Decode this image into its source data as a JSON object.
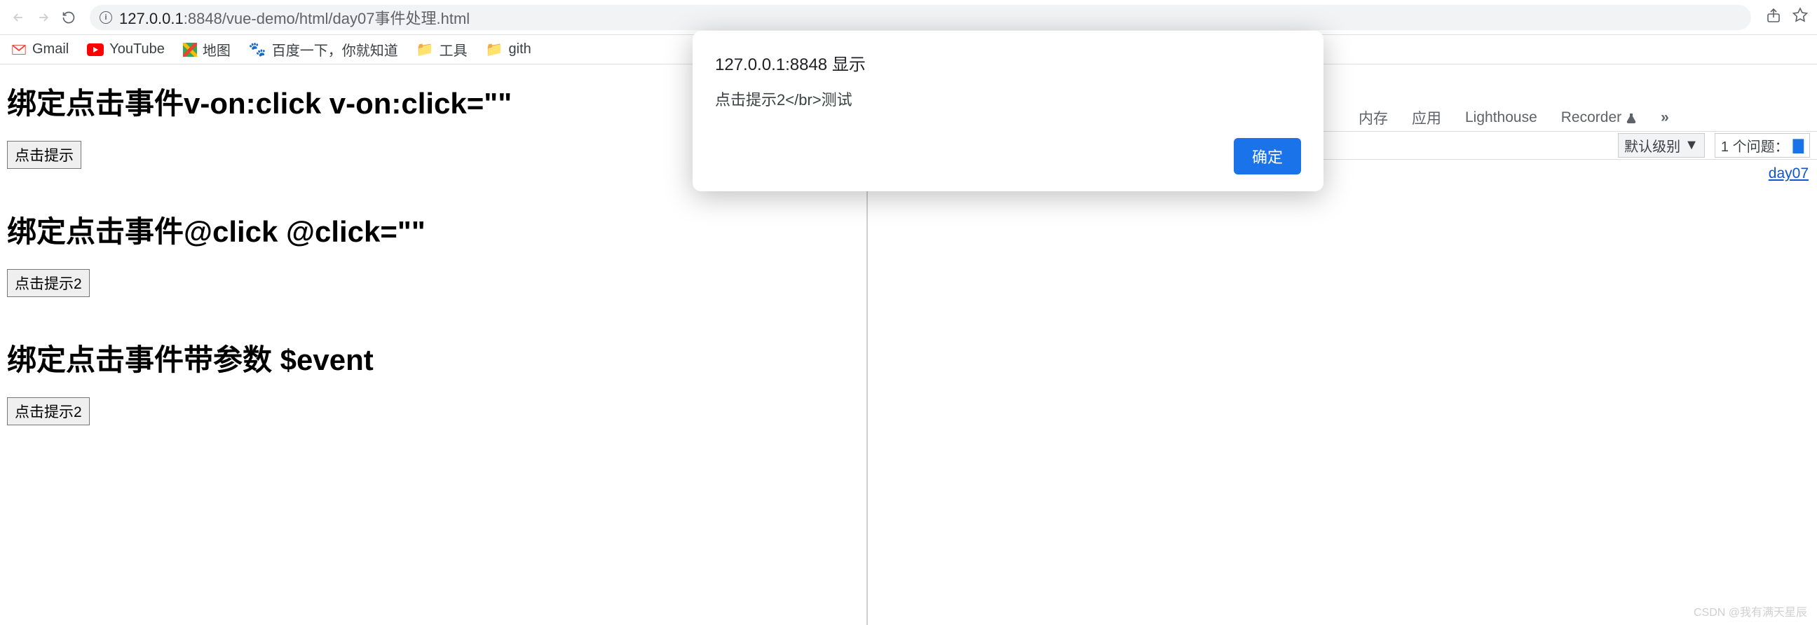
{
  "browser": {
    "url_host": "127.0.0.1",
    "url_port": ":8848",
    "url_path": "/vue-demo/html/day07事件处理.html"
  },
  "bookmarks": [
    {
      "label": "Gmail"
    },
    {
      "label": "YouTube"
    },
    {
      "label": "地图"
    },
    {
      "label": "百度一下，你就知道"
    },
    {
      "label": "工具"
    },
    {
      "label": "gith"
    }
  ],
  "page": {
    "heading1": "绑定点击事件v-on:click v-on:click=\"\"",
    "btn1": "点击提示",
    "heading2": "绑定点击事件@click @click=\"\"",
    "btn2": "点击提示2",
    "heading3": "绑定点击事件带参数 $event",
    "btn3": "点击提示2"
  },
  "alert": {
    "title": "127.0.0.1:8848 显示",
    "message": "点击提示2</br>测试",
    "ok": "确定"
  },
  "devtools": {
    "tabs": {
      "memory": "内存",
      "application": "应用",
      "lighthouse": "Lighthouse",
      "recorder": "Recorder"
    },
    "level": "默认级别",
    "issues_label": "1 个问题：",
    "source_link": "day07"
  },
  "watermark": "CSDN @我有满天星辰"
}
